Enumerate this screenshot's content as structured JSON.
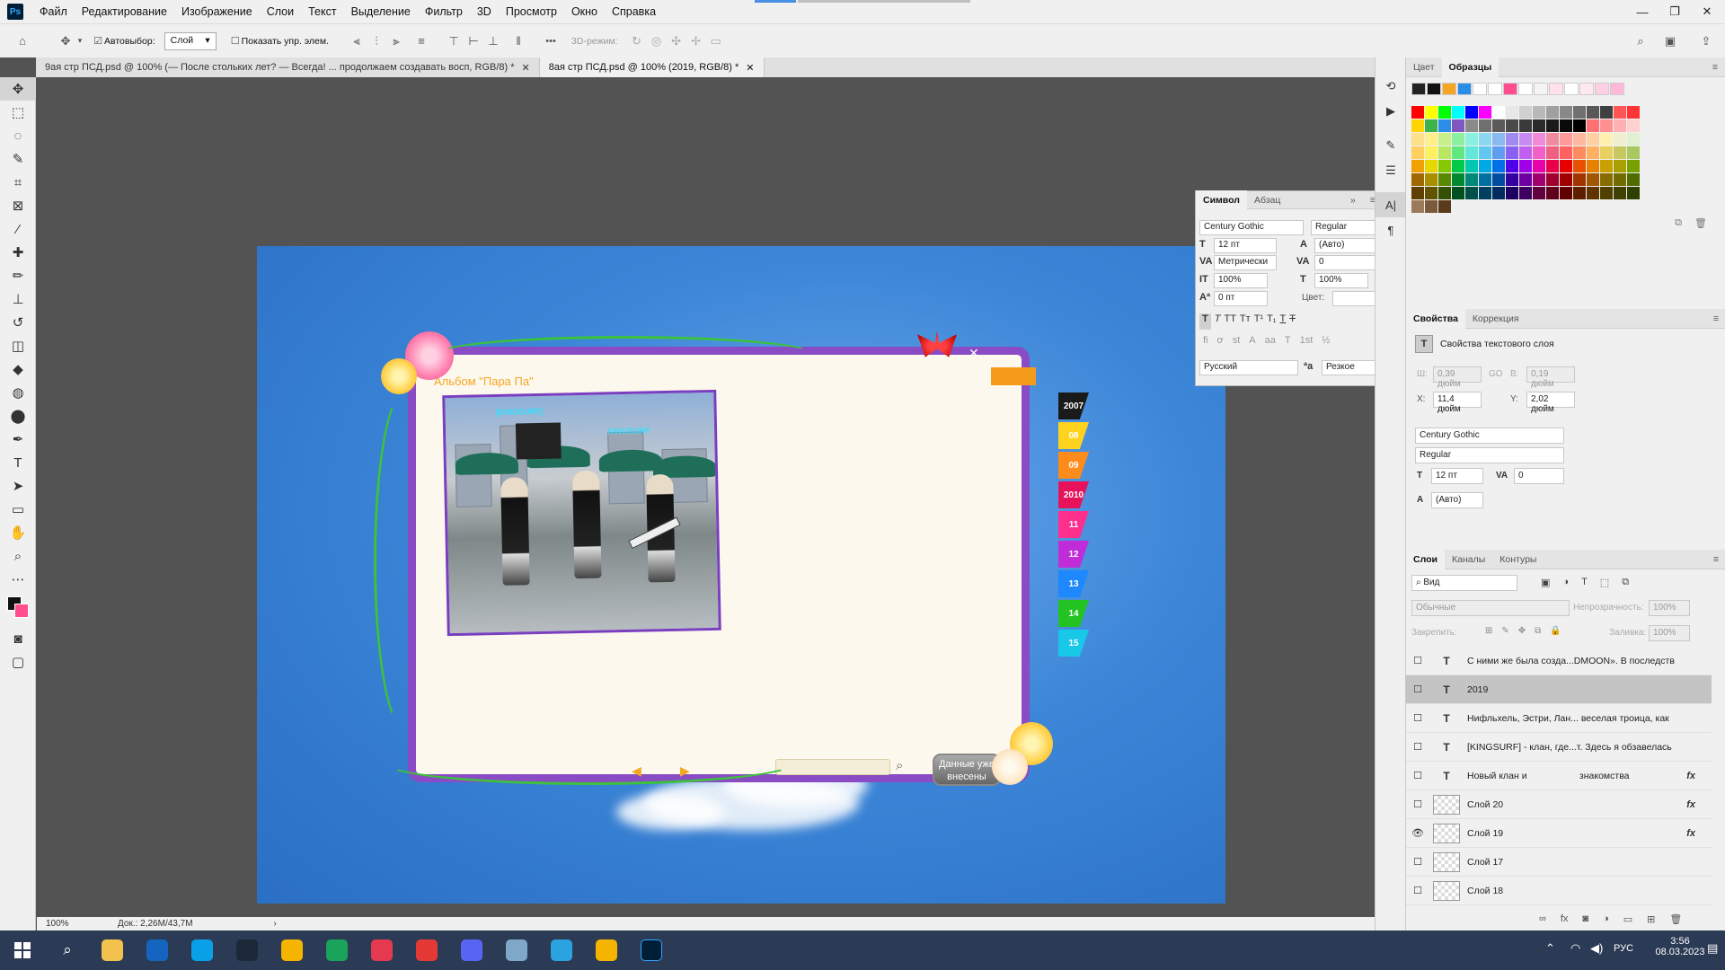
{
  "menu": {
    "app_badge": "Ps",
    "items": [
      "Файл",
      "Редактирование",
      "Изображение",
      "Слои",
      "Текст",
      "Выделение",
      "Фильтр",
      "3D",
      "Просмотр",
      "Окно",
      "Справка"
    ],
    "window_min": "—",
    "window_max": "❐",
    "window_close": "✕"
  },
  "options": {
    "autoselect_label": "Автовыбор:",
    "autoselect_value": "Слой",
    "show_transform_label": "Показать упр. элем.",
    "mode3d_label": "3D-режим:",
    "more": "•••"
  },
  "tabs": [
    {
      "label": "9ая стр ПСД.psd @ 100% (— После стольких лет? — Всегда! ... продолжаем создавать восп, RGB/8) *"
    },
    {
      "label": "8ая стр ПСД.psd @ 100% (2019, RGB/8) *"
    }
  ],
  "canvas": {
    "album_title": "Альбом \"Пара Па\"",
    "photo_labels": [
      "[KINGSURF]",
      "KINGSURF"
    ],
    "year_tabs": [
      {
        "label": "2007",
        "color": "#1a1a1a"
      },
      {
        "label": "08",
        "color": "#ffd21e"
      },
      {
        "label": "09",
        "color": "#ff8c1a"
      },
      {
        "label": "2010",
        "color": "#e8125a"
      },
      {
        "label": "11",
        "color": "#ff2f8e"
      },
      {
        "label": "12",
        "color": "#c02cd8"
      },
      {
        "label": "13",
        "color": "#1e88ff"
      },
      {
        "label": "14",
        "color": "#22c322"
      },
      {
        "label": "15",
        "color": "#18c8e8"
      }
    ],
    "close_x": "✕",
    "data_button_label": "Данные уже внесены",
    "prev_arrow": "◀",
    "next_arrow": "▶"
  },
  "character": {
    "tab_symbol": "Символ",
    "tab_paragraph": "Абзац",
    "font_family": "Century Gothic",
    "font_style": "Regular",
    "size": "12 пт",
    "leading": "(Авто)",
    "kerning": "Метрически",
    "tracking": "0",
    "vscale": "100%",
    "hscale": "100%",
    "baseline": "0 пт",
    "color_label": "Цвет:",
    "language": "Русский",
    "antialias_icon": "ªa",
    "antialias": "Резкое"
  },
  "swatches": {
    "tab_color": "Цвет",
    "tab_swatches": "Образцы",
    "recent": [
      "#222222",
      "#111111",
      "#f5a623",
      "#2a8ee8",
      "#ffffff",
      "#ffffff",
      "#ff4d8d",
      "#ffffff",
      "#f4f4f4",
      "#ffe0ec",
      "#ffffff",
      "#ffe8f0",
      "#ffd0e4",
      "#ffb8d8"
    ],
    "rows": [
      [
        "#ff0000",
        "#ffff00",
        "#00ff00",
        "#00ffff",
        "#0000ff",
        "#ff00ff",
        "#ffffff",
        "#e8e8e8",
        "#d0d0d0",
        "#b8b8b8",
        "#a0a0a0",
        "#888888",
        "#707070",
        "#585858",
        "#404040",
        "#ff5555",
        "#ff3333"
      ],
      [
        "#ffd400",
        "#3cb44b",
        "#2a8ee8",
        "#7e57c2",
        "#8a8a8a",
        "#6f6f6f",
        "#5a5a5a",
        "#4a4a4a",
        "#3a3a3a",
        "#2a2a2a",
        "#1a1a1a",
        "#0a0a0a",
        "#000000",
        "#ff7070",
        "#ff9090",
        "#ffb0b0",
        "#ffd0d0"
      ],
      [
        "#ffe08a",
        "#fff08a",
        "#c8f08a",
        "#8af0a0",
        "#8af0e0",
        "#8ad8f0",
        "#8ab8f0",
        "#a08af0",
        "#c88af0",
        "#f08ad8",
        "#f08aa0",
        "#ff9a9a",
        "#ffb8a0",
        "#ffd0a0",
        "#fff0b0",
        "#f0f0d0",
        "#e0f0d0"
      ],
      [
        "#ffd060",
        "#fff060",
        "#b8e860",
        "#60e880",
        "#60e8d8",
        "#60c8f0",
        "#609cf0",
        "#8a60f0",
        "#c060f0",
        "#f060c8",
        "#f06080",
        "#ff6060",
        "#ff8a60",
        "#ffb060",
        "#e8d060",
        "#c8c860",
        "#a8c860"
      ],
      [
        "#f0a000",
        "#e8d800",
        "#88c800",
        "#00c848",
        "#00c8b0",
        "#00a8e8",
        "#0070e8",
        "#5000e8",
        "#a000e8",
        "#e800a8",
        "#e80048",
        "#e80000",
        "#e85000",
        "#e88000",
        "#c8a000",
        "#a8a000",
        "#78a000"
      ],
      [
        "#a06800",
        "#a89000",
        "#5a8800",
        "#008830",
        "#008878",
        "#0070a0",
        "#004ca0",
        "#3400a0",
        "#6c00a0",
        "#a00070",
        "#a00030",
        "#a00000",
        "#a03400",
        "#a05800",
        "#886c00",
        "#706c00",
        "#506c00"
      ],
      [
        "#604000",
        "#605400",
        "#345000",
        "#005020",
        "#005048",
        "#004060",
        "#002c60",
        "#1e0060",
        "#3e0060",
        "#600040",
        "#60001c",
        "#600000",
        "#601e00",
        "#603400",
        "#504000",
        "#404000",
        "#2e4000"
      ],
      [
        "#9a7a5a",
        "#7a5a3a",
        "#5a3a1a"
      ]
    ]
  },
  "properties": {
    "tab_properties": "Свойства",
    "tab_correction": "Коррекция",
    "header": "Свойства текстового слоя",
    "w_label": "Ш:",
    "w_value": "0,39 дюйм",
    "link": "GO",
    "h_label": "В:",
    "h_value": "0,19 дюйм",
    "x_label": "X:",
    "x_value": "11,4 дюйм",
    "y_label": "Y:",
    "y_value": "2,02 дюйм",
    "font_family": "Century Gothic",
    "font_style": "Regular",
    "size": "12 пт",
    "tracking": "0",
    "leading": "(Авто)"
  },
  "layers": {
    "tab_layers": "Слои",
    "tab_channels": "Каналы",
    "tab_paths": "Контуры",
    "search_placeholder": "Вид",
    "blend_mode": "Обычные",
    "opacity_label": "Непрозрачность:",
    "opacity_value": "100%",
    "lock_label": "Закрепить:",
    "fill_label": "Заливка:",
    "fill_value": "100%",
    "items": [
      {
        "name": "С ними же была созда...DMOON». В последств",
        "kind": "T",
        "selected": false,
        "visible": false,
        "fx": false
      },
      {
        "name": "2019",
        "kind": "T",
        "selected": true,
        "visible": false,
        "fx": false
      },
      {
        "name": "Нифльхель, Эстри, Лан... веселая троица, как",
        "kind": "T",
        "selected": false,
        "visible": false,
        "fx": false
      },
      {
        "name": "[KINGSURF] - клан, где...т. Здесь я обзавелась",
        "kind": "T",
        "selected": false,
        "visible": false,
        "fx": false
      },
      {
        "name": "Новый клан и                    знакомства",
        "kind": "T",
        "selected": false,
        "visible": false,
        "fx": true
      },
      {
        "name": "Слой 20",
        "kind": "img",
        "selected": false,
        "visible": false,
        "fx": true
      },
      {
        "name": "Слой 19",
        "kind": "img",
        "selected": false,
        "visible": true,
        "fx": true
      },
      {
        "name": "Слой 17",
        "kind": "img",
        "selected": false,
        "visible": false,
        "fx": false
      },
      {
        "name": "Слой 18",
        "kind": "img",
        "selected": false,
        "visible": false,
        "fx": false
      }
    ]
  },
  "status": {
    "zoom": "100%",
    "doc": "Док.: 2,26M/43,7M",
    "arrow": "›"
  },
  "taskbar": {
    "lang": "РУС",
    "time": "3:56",
    "date": "08.03.2023",
    "icons": [
      {
        "name": "file-explorer-icon",
        "color": "#f2c14e"
      },
      {
        "name": "xbox-icon",
        "color": "#1565c0"
      },
      {
        "name": "skype-icon",
        "color": "#0aa0e8"
      },
      {
        "name": "steam-icon",
        "color": "#1b2838"
      },
      {
        "name": "chrome-icon",
        "color": "#f4b400"
      },
      {
        "name": "edge-icon",
        "color": "#1aa35a"
      },
      {
        "name": "camera-icon",
        "color": "#e53950"
      },
      {
        "name": "joystick-icon",
        "color": "#e53935"
      },
      {
        "name": "discord-icon",
        "color": "#5865f2"
      },
      {
        "name": "game-icon",
        "color": "#7fa8c8"
      },
      {
        "name": "telegram-icon",
        "color": "#2aa3e0"
      },
      {
        "name": "chrome-icon-2",
        "color": "#f4b400"
      },
      {
        "name": "photoshop-icon",
        "color": "#001e36"
      }
    ]
  }
}
